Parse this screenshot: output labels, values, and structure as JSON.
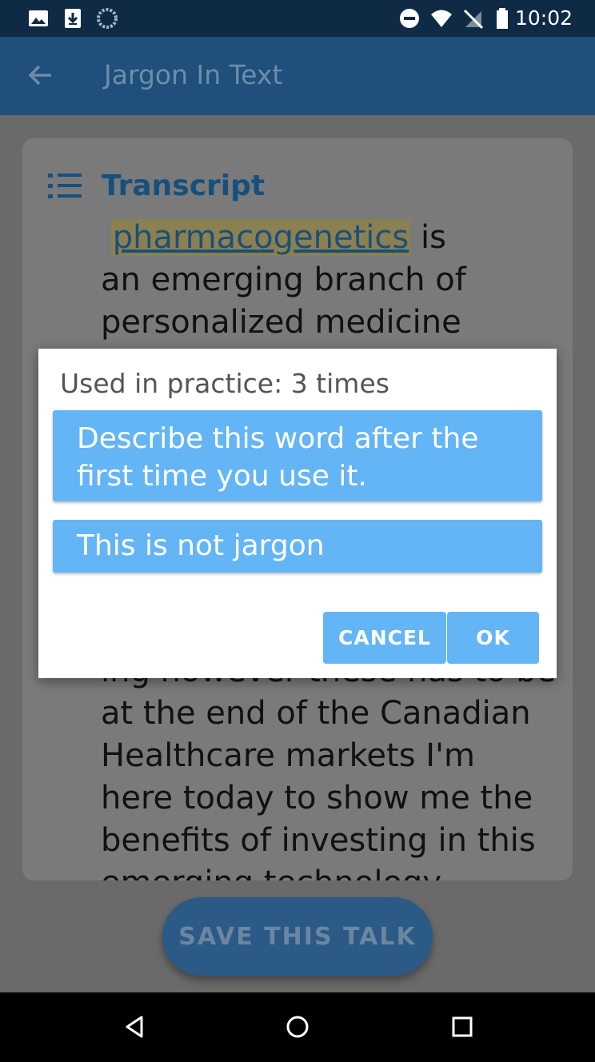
{
  "status_bar": {
    "time": "10:02",
    "left_icons": [
      "image-icon",
      "download-icon",
      "sync-icon"
    ],
    "right_icons": [
      "do-not-disturb-icon",
      "wifi-icon",
      "no-signal-icon",
      "battery-icon"
    ]
  },
  "app_bar": {
    "title": "Jargon In Text",
    "back_icon": "arrow-back-icon"
  },
  "transcript": {
    "heading": "Transcript",
    "highlighted_word": "pharmacogenetics",
    "line1_rest": " is",
    "line2": "an emerging branch of",
    "line3": "personalized medicine",
    "lower_partial": "ing however these has to be",
    "lower_lines": [
      "at the end of the Canadian",
      "Healthcare markets I'm",
      "here today to show me the",
      "benefits of investing in this",
      "emerging technology"
    ]
  },
  "dialog": {
    "usage_text": "Used in practice: 3 times",
    "option_describe_line1": "Describe this word after the",
    "option_describe_line2": "first time you use it.",
    "option_not_jargon": "This is not jargon",
    "cancel_label": "CANCEL",
    "ok_label": "OK"
  },
  "save_button_label": "SAVE THIS TALK",
  "colors": {
    "status_bar": "#0e2a45",
    "app_bar": "#1f4f7a",
    "dialog_option": "#64b5f6",
    "scrim": "#6a6a6a"
  }
}
